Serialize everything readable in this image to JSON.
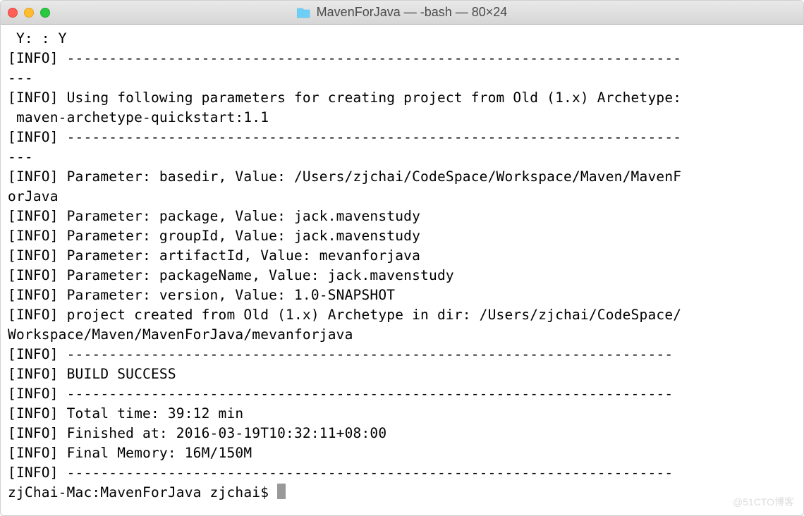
{
  "titlebar": {
    "title": "MavenForJava — -bash — 80×24"
  },
  "terminal": {
    "lines": [
      " Y: : Y",
      "[INFO] -------------------------------------------------------------------------",
      "---",
      "[INFO] Using following parameters for creating project from Old (1.x) Archetype:",
      " maven-archetype-quickstart:1.1",
      "[INFO] -------------------------------------------------------------------------",
      "---",
      "[INFO] Parameter: basedir, Value: /Users/zjchai/CodeSpace/Workspace/Maven/MavenF",
      "orJava",
      "[INFO] Parameter: package, Value: jack.mavenstudy",
      "[INFO] Parameter: groupId, Value: jack.mavenstudy",
      "[INFO] Parameter: artifactId, Value: mevanforjava",
      "[INFO] Parameter: packageName, Value: jack.mavenstudy",
      "[INFO] Parameter: version, Value: 1.0-SNAPSHOT",
      "[INFO] project created from Old (1.x) Archetype in dir: /Users/zjchai/CodeSpace/",
      "Workspace/Maven/MavenForJava/mevanforjava",
      "[INFO] ------------------------------------------------------------------------",
      "[INFO] BUILD SUCCESS",
      "[INFO] ------------------------------------------------------------------------",
      "[INFO] Total time: 39:12 min",
      "[INFO] Finished at: 2016-03-19T10:32:11+08:00",
      "[INFO] Final Memory: 16M/150M",
      "[INFO] ------------------------------------------------------------------------"
    ],
    "prompt": "zjChai-Mac:MavenForJava zjchai$ "
  },
  "watermark": "@51CTO博客"
}
